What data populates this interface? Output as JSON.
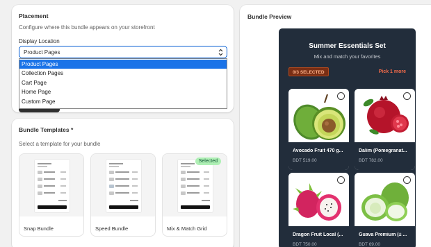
{
  "placement": {
    "title": "Placement",
    "helper": "Configure where this bundle appears on your storefront",
    "display_label": "Display Location",
    "selected": "Product Pages",
    "options": [
      "Product Pages",
      "Collection Pages",
      "Cart Page",
      "Home Page",
      "Custom Page"
    ]
  },
  "templates": {
    "title": "Bundle Templates *",
    "helper": "Select a template for your bundle",
    "items": [
      {
        "label": "Snap Bundle",
        "selected": false
      },
      {
        "label": "Speed Bundle",
        "selected": false
      },
      {
        "label": "Mix & Match Grid",
        "selected": true
      }
    ],
    "selected_badge": "Selected"
  },
  "preview": {
    "title": "Bundle Preview",
    "bundle_title": "Summer Essentials Set",
    "bundle_subtitle": "Mix and match your favorites",
    "selection_status": "0/3 SELECTED",
    "pick_more": "Pick 1 more",
    "products": [
      {
        "name": "Avocado Fruit 470 g...",
        "price": "BDT 519.00",
        "icon": "avocado-image"
      },
      {
        "name": "Dalim (Pomegranat...",
        "price": "BDT 782.00",
        "icon": "pomegranate-image"
      },
      {
        "name": "Dragon Fruit Local (...",
        "price": "BDT 750.00",
        "icon": "dragon-fruit-image"
      },
      {
        "name": "Guava Premium (± ...",
        "price": "BDT 69.00",
        "icon": "guava-image"
      }
    ]
  },
  "colors": {
    "accent": "#005bd3",
    "preview_bg": "#222d3b",
    "selected_option": "#1a73e8",
    "pick_more": "#f06a4a"
  }
}
